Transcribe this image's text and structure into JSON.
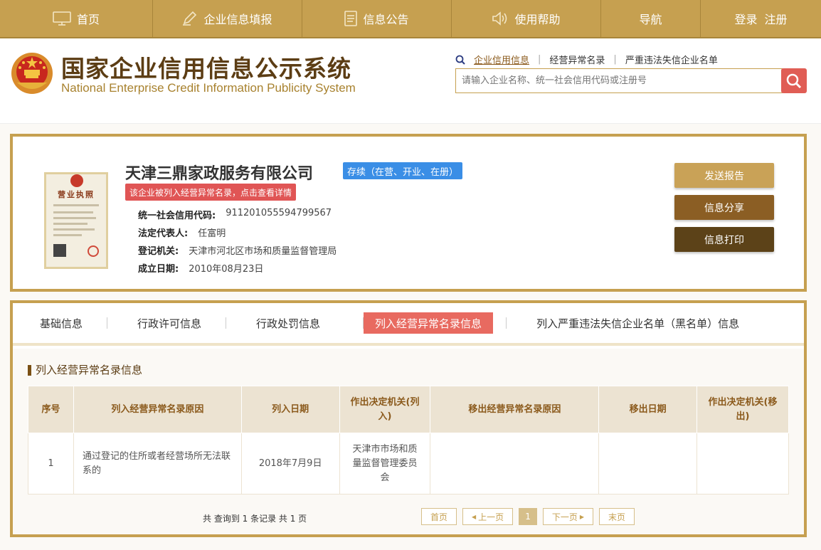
{
  "nav": {
    "items": [
      {
        "label": "首页",
        "icon": "monitor-icon"
      },
      {
        "label": "企业信息填报",
        "icon": "pen-icon"
      },
      {
        "label": "信息公告",
        "icon": "document-icon"
      },
      {
        "label": "使用帮助",
        "icon": "speaker-icon"
      },
      {
        "label": "导航",
        "icon": ""
      }
    ],
    "login": "登录",
    "register": "注册"
  },
  "header": {
    "title_cn": "国家企业信用信息公示系统",
    "title_en": "National Enterprise Credit Information Publicity System",
    "search_types": [
      "企业信用信息",
      "经营异常名录",
      "严重违法失信企业名单"
    ],
    "search_placeholder": "请输入企业名称、统一社会信用代码或注册号"
  },
  "company": {
    "name": "天津三鼎家政服务有限公司",
    "status": "存续（在营、开业、在册）",
    "alert": "该企业被列入经营异常名录，点击查看详情",
    "license_title": "营业执照",
    "fields": [
      {
        "label": "统一社会信用代码:",
        "value": "911201055594799567"
      },
      {
        "label": "法定代表人:",
        "value": "任富明"
      },
      {
        "label": "登记机关:",
        "value": "天津市河北区市场和质量监督管理局"
      },
      {
        "label": "成立日期:",
        "value": "2010年08月23日"
      }
    ],
    "buttons": {
      "send": "发送报告",
      "share": "信息分享",
      "print": "信息打印"
    }
  },
  "tabs": [
    "基础信息",
    "行政许可信息",
    "行政处罚信息",
    "列入经营异常名录信息",
    "列入严重违法失信企业名单（黑名单）信息"
  ],
  "active_tab": 3,
  "section_title": "列入经营异常名录信息",
  "table": {
    "headers": [
      "序号",
      "列入经营异常名录原因",
      "列入日期",
      "作出决定机关(列入)",
      "移出经营异常名录原因",
      "移出日期",
      "作出决定机关(移出)"
    ],
    "rows": [
      [
        "1",
        "通过登记的住所或者经营场所无法联系的",
        "2018年7月9日",
        "天津市市场和质量监督管理委员会",
        "",
        "",
        ""
      ]
    ]
  },
  "pagination": {
    "summary": "共 查询到 1 条记录 共 1 页",
    "first": "首页",
    "prev": "上一页",
    "current": "1",
    "next": "下一页",
    "last": "末页"
  },
  "colors": {
    "gold": "#c6a050",
    "brown": "#5c3d14",
    "red": "#e05555",
    "blue": "#3a8ee6"
  }
}
